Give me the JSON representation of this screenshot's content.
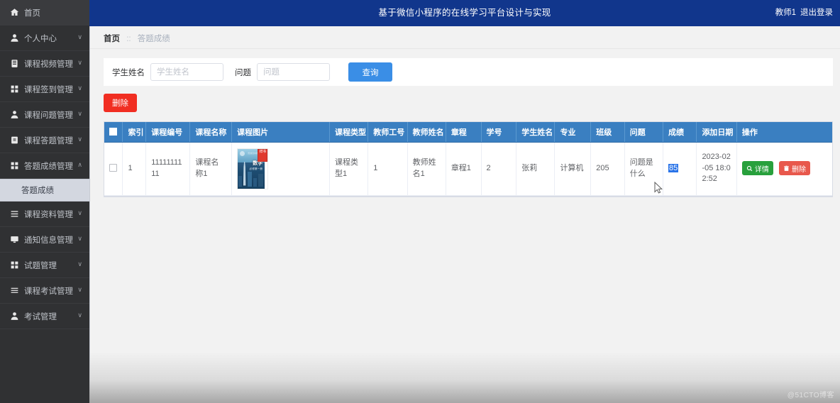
{
  "header": {
    "title": "基于微信小程序的在线学习平台设计与实现",
    "user_name": "教师1",
    "logout_label": "退出登录",
    "bg_color": "#11368c"
  },
  "sidebar": {
    "bg_color": "#303133",
    "items": [
      {
        "label": "首页",
        "icon": "home-icon",
        "has_arrow": false,
        "arrow": ""
      },
      {
        "label": "个人中心",
        "icon": "user-icon",
        "has_arrow": true,
        "arrow": "∨"
      },
      {
        "label": "课程视频管理",
        "icon": "clipboard-icon",
        "has_arrow": true,
        "arrow": "∨"
      },
      {
        "label": "课程签到管理",
        "icon": "grid-icon",
        "has_arrow": true,
        "arrow": "∨"
      },
      {
        "label": "课程问题管理",
        "icon": "person-icon",
        "has_arrow": true,
        "arrow": "∨"
      },
      {
        "label": "课程答题管理",
        "icon": "note-icon",
        "has_arrow": true,
        "arrow": "∨"
      },
      {
        "label": "答题成绩管理",
        "icon": "grid-icon",
        "has_arrow": true,
        "arrow": "∧"
      },
      {
        "label": "课程资料管理",
        "icon": "list-icon",
        "has_arrow": true,
        "arrow": "∨"
      },
      {
        "label": "通知信息管理",
        "icon": "monitor-icon",
        "has_arrow": true,
        "arrow": "∨"
      },
      {
        "label": "试题管理",
        "icon": "grid-icon",
        "has_arrow": true,
        "arrow": "∨"
      },
      {
        "label": "课程考试管理",
        "icon": "rows-icon",
        "has_arrow": true,
        "arrow": "∨"
      },
      {
        "label": "考试管理",
        "icon": "person-icon",
        "has_arrow": true,
        "arrow": "∨"
      }
    ],
    "active_sub_label": "答题成绩"
  },
  "breadcrumb": {
    "home": "首页",
    "separator": "::",
    "current": "答题成绩"
  },
  "filter": {
    "name_label": "学生姓名",
    "name_value": "",
    "name_placeholder": "学生姓名",
    "question_label": "问题",
    "question_value": "",
    "question_placeholder": "问题",
    "query_button": "查询",
    "query_color": "#3a8ee6"
  },
  "toolbar": {
    "delete_button": "删除",
    "delete_color": "#f12e22"
  },
  "table": {
    "header_bg": "#3a7fc1",
    "columns": [
      "",
      "索引",
      "课程编号",
      "课程名称",
      "课程图片",
      "课程类型",
      "教师工号",
      "教师姓名",
      "章程",
      "学号",
      "学生姓名",
      "专业",
      "班级",
      "问题",
      "成绩",
      "添加日期",
      "操作"
    ],
    "rows": [
      {
        "index": "1",
        "course_no": "1111111111",
        "course_name": "课程名称1",
        "course_image": "math-textbook-cover",
        "course_type": "课程类型1",
        "teacher_no": "1",
        "teacher_name": "教师姓名1",
        "chapter": "章程1",
        "student_no": "2",
        "student_name": "张莉",
        "major": "计算机",
        "class": "205",
        "question": "问题是什么",
        "score": "85",
        "score_selected": true,
        "add_date": "2023-02-05 18:02:52",
        "actions": {
          "detail_label": "详情",
          "detail_color": "#28a03c",
          "delete_label": "删除",
          "delete_color": "#e8584c"
        }
      }
    ]
  },
  "book_cover": {
    "title": "数学",
    "subtitle": "必修第一册",
    "top_text": "普通高中教科书",
    "seal_text": "样书"
  },
  "watermark": "@51CTO博客"
}
